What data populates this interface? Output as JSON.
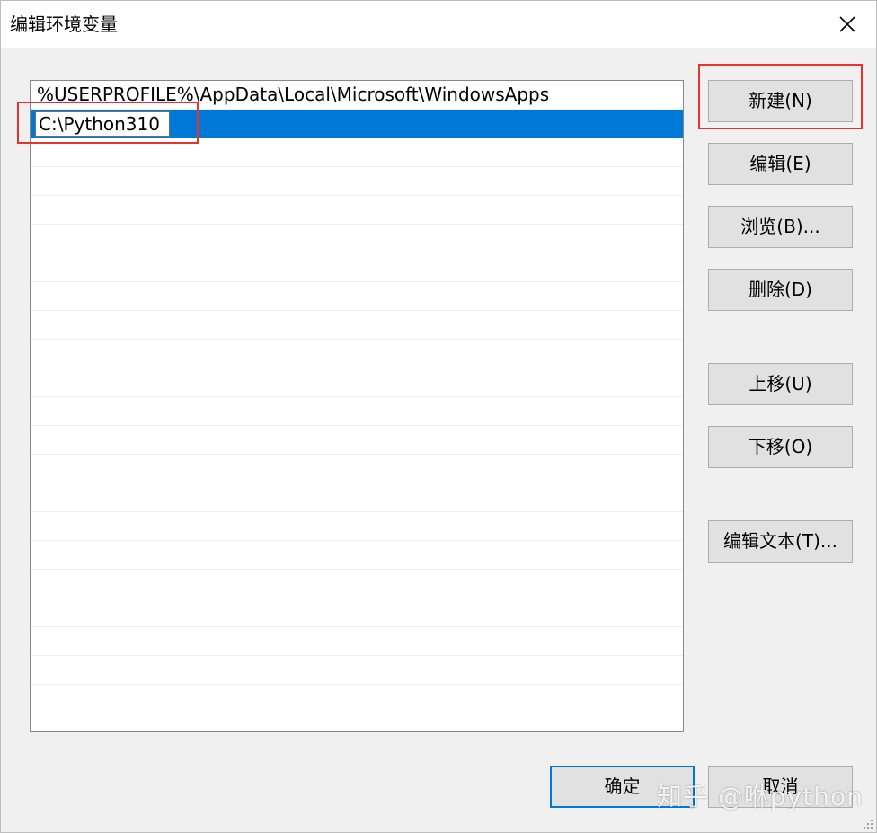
{
  "window": {
    "title": "编辑环境变量",
    "close_icon": "close-icon"
  },
  "list": {
    "items": [
      "%USERPROFILE%\\AppData\\Local\\Microsoft\\WindowsApps",
      "C:\\Python310"
    ],
    "editing_value": "C:\\Python310",
    "selected_index": 1
  },
  "buttons": {
    "new": "新建(N)",
    "edit": "编辑(E)",
    "browse": "浏览(B)...",
    "delete": "删除(D)",
    "move_up": "上移(U)",
    "move_down": "下移(O)",
    "edit_text": "编辑文本(T)...",
    "ok": "确定",
    "cancel": "取消"
  },
  "watermark": "知乎 @咻python",
  "colors": {
    "selection": "#0078d7",
    "highlight_box": "#e8322e",
    "button_face": "#e1e1e1",
    "default_button_border": "#0078d7"
  }
}
